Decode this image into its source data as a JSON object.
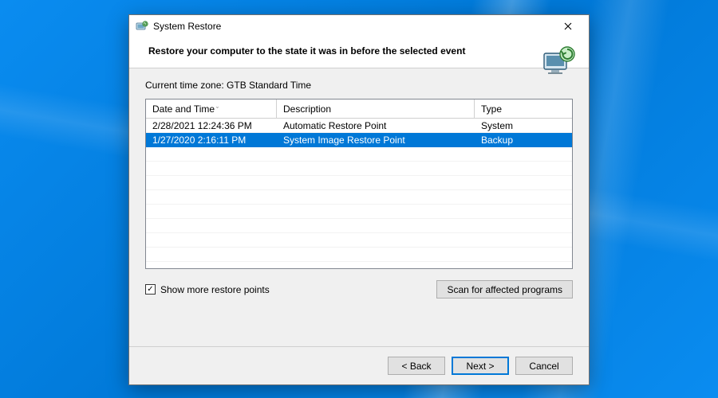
{
  "window": {
    "title": "System Restore"
  },
  "header": {
    "heading": "Restore your computer to the state it was in before the selected event"
  },
  "timezone_label": "Current time zone: GTB Standard Time",
  "table": {
    "columns": {
      "date": "Date and Time",
      "desc": "Description",
      "type": "Type"
    },
    "rows": [
      {
        "date": "2/28/2021 12:24:36 PM",
        "desc": "Automatic Restore Point",
        "type": "System",
        "selected": false
      },
      {
        "date": "1/27/2020 2:16:11 PM",
        "desc": "System Image Restore Point",
        "type": "Backup",
        "selected": true
      }
    ]
  },
  "checkbox": {
    "label": "Show more restore points",
    "checked": true
  },
  "buttons": {
    "scan": "Scan for affected programs",
    "back": "< Back",
    "next": "Next >",
    "cancel": "Cancel"
  }
}
